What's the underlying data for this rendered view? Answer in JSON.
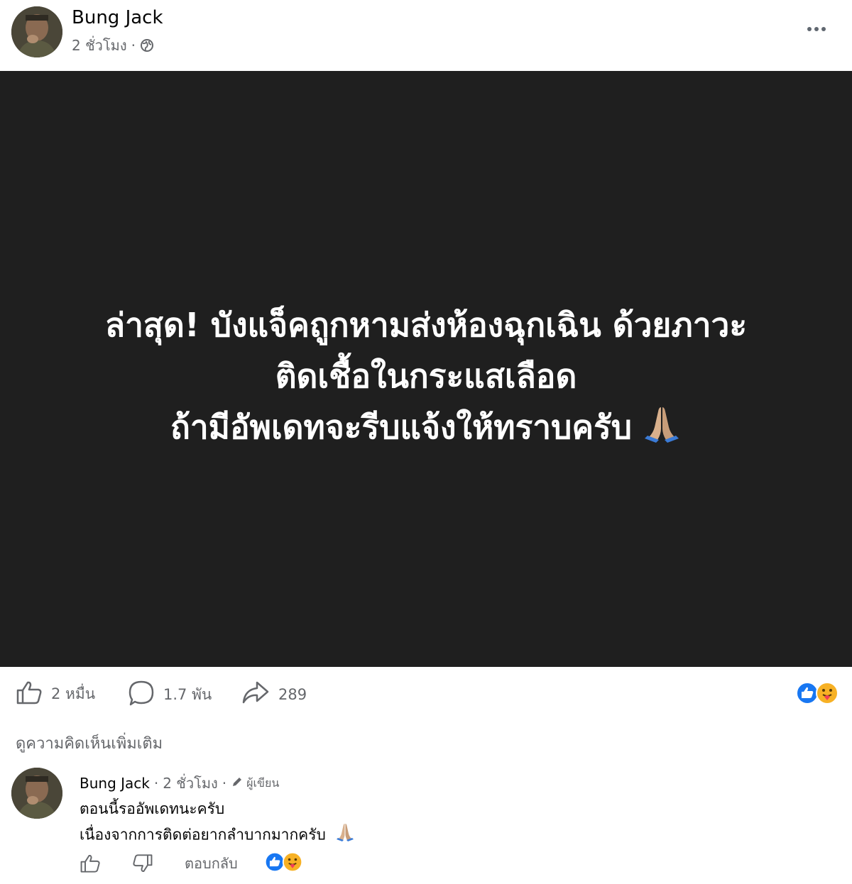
{
  "post": {
    "author": "Bung Jack",
    "time": "2 ชั่วโมง",
    "separator": "·",
    "privacy_icon": "globe-icon",
    "more_icon": "more-horizontal-icon"
  },
  "media": {
    "lines": [
      "ล่าสุด! บังแจ็คถูกหามส่งห้องฉุกเฉิน ด้วยภาวะ",
      "ติดเชื้อในกระแสเลือด",
      "ถ้ามีอัพเดทจะรีบแจ้งให้ทราบครับ"
    ],
    "emoji": "pray-emoji"
  },
  "actions": {
    "likes": "2 หมื่น",
    "comments": "1.7 พัน",
    "shares": "289",
    "reactions": [
      "like-reaction-icon",
      "care-reaction-icon"
    ]
  },
  "more_comments_label": "ดูความคิดเห็นเพิ่มเติม",
  "comment": {
    "author": "Bung Jack",
    "separator": "·",
    "time": "2 ชั่วโมง",
    "author_badge": "ผู้เขียน",
    "text_line1": "ตอนนี้รออัพเดทนะครับ",
    "text_line2": "เนื่องจากการติดต่อยากลำบากมากครับ",
    "reply_label": "ตอบกลับ"
  },
  "colors": {
    "media_bg": "#1f1f1f",
    "secondary_text": "#65676b",
    "like_blue": "#1877f2"
  }
}
